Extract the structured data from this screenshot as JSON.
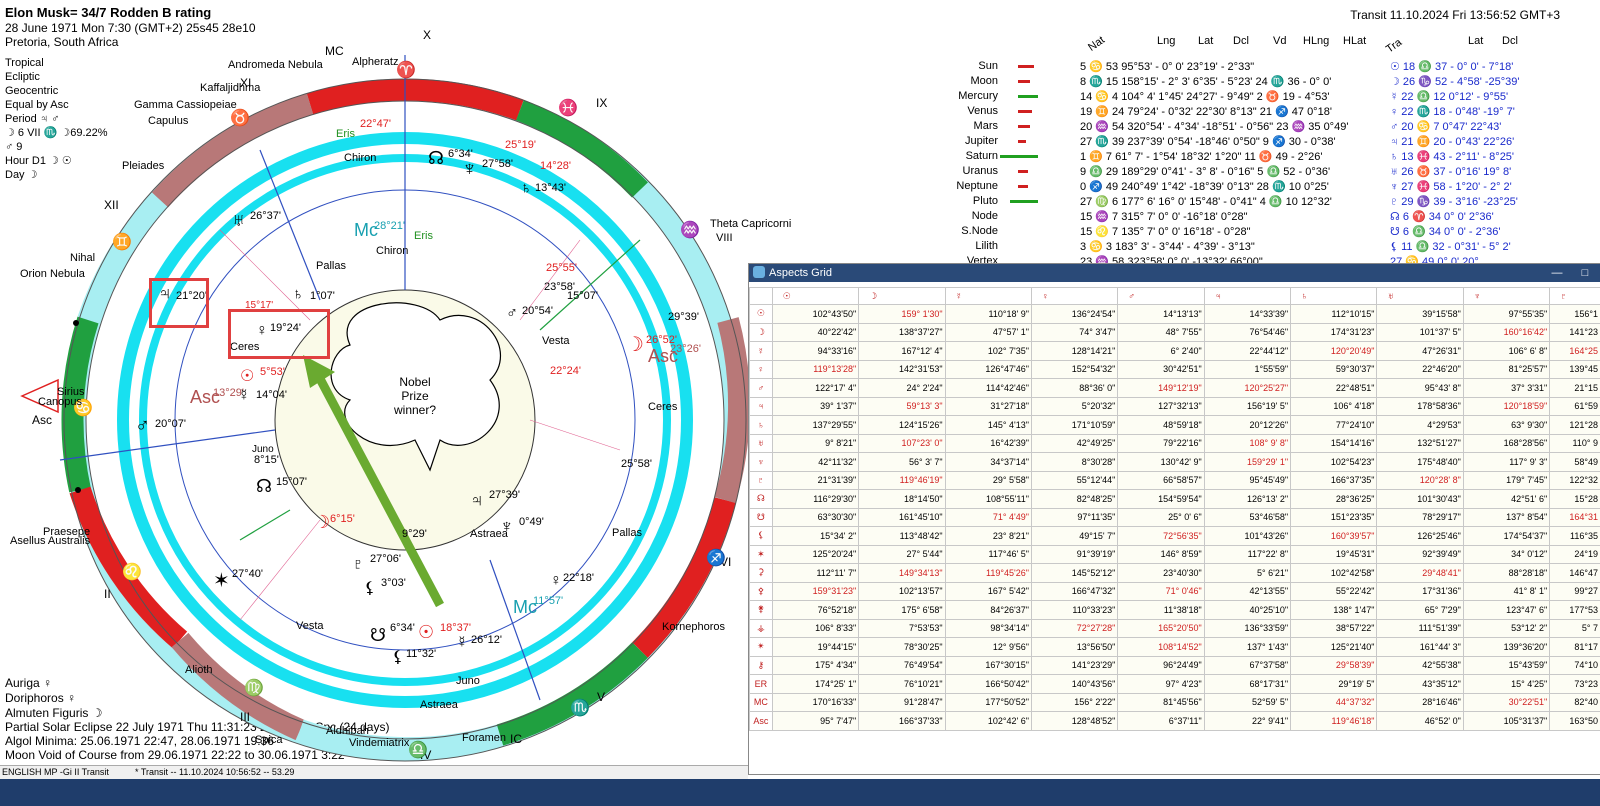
{
  "header": {
    "title": "Elon Musk= 34/7 Rodden B rating",
    "date_line": "28 June 1971  Mon   7:30 (GMT+2) 25s45  28e10",
    "place": "Pretoria, South Africa",
    "transit": "Transit 11.10.2024  Fri 13:56:52 GMT+3"
  },
  "settings": {
    "lines": [
      "Tropical",
      "Ecliptic",
      "Geocentric",
      "Equal by Asc",
      "Period ♃ ♂",
      "☽ 6 VII ♏ ☽69.22%",
      "♂ 9",
      "Hour D1 ☽ ☉",
      "Day ☽"
    ]
  },
  "bottom_info": {
    "lines": [
      "Auriga ♀",
      "Doriphoros ♀",
      "Almuten Figuris ☽",
      "Partial Solar Eclipse 22 July 1971 Thu 11:31:23 28°55'32\" Cnc (24 days)",
      "Algol Minima: 25.06.1971 22:47,  28.06.1971 19:36",
      "Moon Void of Course from 29.06.1971 22:22 to 30.06.1971  3:22"
    ]
  },
  "status": {
    "left": "ENGLISH MP -Gi II Transit",
    "tab": "* Transit -- 11.10.2024 10:56:52 -- 53.29"
  },
  "planet_table": {
    "col_nat": "Nat",
    "col_lng": "Lng",
    "col_lat": "Lat",
    "col_dcl": "Dcl",
    "col_vd": "Vd",
    "col_hlng": "HLng",
    "col_hlat": "HLat",
    "col_tra": "Tra",
    "col_tlat": "Lat",
    "col_tdcl": "Dcl",
    "rows": [
      {
        "name": "Sun",
        "val": "5 ♋ 53   95°53'  - 0° 0'   23°19'  - 2°33\"",
        "tv": "☉  18 ♎ 37  - 0° 0'   - 7°18'",
        "bar": "#d02020"
      },
      {
        "name": "Moon",
        "val": "8 ♏ 15   158°15'  - 2° 3'    6°35'  - 5°23'  24 ♏ 36  - 0° 0'",
        "tv": "☽  26 ♑ 52  - 4°58'  -25°39'",
        "bar": "#d02020"
      },
      {
        "name": "Mercury",
        "val": "14 ♋ 4   104° 4'    1°45'   24°27'  - 9°49\"   2 ♉ 19  - 4°53'",
        "tv": "☿  22 ♎ 12    0°12'   - 9°55'",
        "bar": "#20a020"
      },
      {
        "name": "Venus",
        "val": "19 ♊ 24   79°24'  - 0°32'   22°30'   8°13\"  21 ♐ 47    0°18'",
        "tv": "♀  22 ♏ 18  - 0°48'  -19° 7'",
        "bar": "#d02020"
      },
      {
        "name": "Mars",
        "val": "20 ♒ 54  320°54'  - 4°34'  -18°51'  - 0°56\"  23 ♒ 35    0°49'",
        "tv": "♂  20 ♋ 7    0°47'   22°43'",
        "bar": "#d02020"
      },
      {
        "name": "Jupiter",
        "val": "27 ♏ 39  237°39'    0°54'  -18°46'   0°50\"   9 ♐ 30  - 0°38'",
        "tv": "♃  21 ♊ 20  - 0°43'   22°26'",
        "bar": "#d02020"
      },
      {
        "name": "Saturn",
        "val": "1 ♊ 7    61° 7'  - 1°54'   18°32'   1°20\"  11 ♉ 49  - 2°26'",
        "tv": "♄  13 ♓ 43  - 2°11'  - 8°25'",
        "bar": "#20a020"
      },
      {
        "name": "Uranus",
        "val": "9 ♎ 29  189°29'    0°41'  - 3° 8'  - 0°16\"   5 ♎ 52  - 0°36'",
        "tv": "♅  26 ♉ 37  - 0°16'   19° 8'",
        "bar": "#d02020"
      },
      {
        "name": "Neptune",
        "val": "0 ♐ 49  240°49'    1°42'  -18°39'   0°13\"  28 ♏ 10    0°25'",
        "tv": "♆  27 ♓ 58  - 1°20'  - 2° 2'",
        "bar": "#d02020"
      },
      {
        "name": "Pluto",
        "val": "27 ♍ 6   177° 6'   16° 0'   15°48'  - 0°41\"   4 ♎ 10   12°32'",
        "tv": "♇  29 ♑ 39  - 3°16'  -23°25'",
        "bar": "#20a020"
      },
      {
        "name": "Node",
        "val": "15 ♒ 7   315° 7'    0° 0'  -16°18'   0°28\"",
        "tv": "☊   6 ♈ 34    0° 0'    2°36'",
        "bar": ""
      },
      {
        "name": "S.Node",
        "val": "15 ♌ 7   135° 7'    0° 0'   16°18'  - 0°28\"",
        "tv": "☋   6 ♎ 34    0° 0'  - 2°36'",
        "bar": ""
      },
      {
        "name": "Lilith",
        "val": "3 ♋ 3   183° 3'  - 3°44'  - 4°39'  - 3°13\"",
        "tv": "⚸  11 ♎ 32  - 0°31'  - 5° 2'",
        "bar": ""
      },
      {
        "name": "Vertex",
        "val": "23 ♒ 58  323°58'    0° 0'  -13°32'  66°00\"",
        "tv": "   27 ♋ 49    0° 0'   20°...",
        "bar": ""
      }
    ]
  },
  "chart": {
    "signs": {
      "aries": "♈",
      "taurus": "♉",
      "gemini": "♊",
      "cancer": "♋",
      "leo": "♌",
      "virgo": "♍",
      "libra": "♎",
      "scorpio": "♏",
      "sagittarius": "♐",
      "capricorn": "♑",
      "aquarius": "♒",
      "pisces": "♓"
    },
    "houses": {
      "x": "X",
      "xi": "XI",
      "xii": "XII",
      "ix": "IX",
      "viii": "VIII",
      "vi": "VI",
      "v": "V",
      "iv": "IV",
      "iii": "III",
      "ii": "II",
      "i": "I",
      "mc": "MC",
      "ic": "IC"
    },
    "stars": {
      "andromeda": "Andromeda Nebula",
      "alpheratz": "Alpheratz",
      "kaffaljidhma": "Kaffaljidhma",
      "gamma": "Gamma Cassiopeiae",
      "capulus": "Capulus",
      "pleiades": "Pleiades",
      "nihal": "Nihal",
      "orion": "Orion Nebula",
      "sirius": "Sirius",
      "canopus": "Canopus",
      "asc": "Asc",
      "praesepe": "Praesepe",
      "asellus": "Asellus Australis",
      "alioth": "Alioth",
      "aldhibah": "Aldhibah",
      "spica": "Spica",
      "vindemiatrix": "Vindemiatrix",
      "foramen": "Foramen",
      "kornephoros": "Kornephoros",
      "theta": "Theta Capricorni"
    },
    "labels": {
      "ceres_top": "Ceres",
      "ceres_mid": "Ceres",
      "eris_top": "Eris",
      "eris_mid": "Eris",
      "chiron_top": "Chiron",
      "chiron_mid": "Chiron",
      "pallas_top": "Pallas",
      "pallas_mid": "Pallas",
      "juno_mid": "Juno",
      "juno_bot": "Juno",
      "vesta_mid": "Vesta",
      "vesta_bot": "Vesta",
      "astraea_mid": "Astraea",
      "astraea_bot": "Astraea",
      "mc_val": "28°21'",
      "mc_t_val": "11°57'",
      "asc_val": "13°29'",
      "asc_t_val": "23°26'",
      "j_nat": "21°20'",
      "v_nat": "19°24'",
      "sun_nat": "5°53'",
      "merc_nat": "14°04'",
      "mars_nat": "20°07'",
      "moon_nat": "8°15'",
      "node_nat": "15°07'",
      "sat_nat": "1°07'",
      "ura_nat": "26°37'",
      "nep_nat": "0°49'",
      "jup2": "27°39'",
      "plu_nat": "27°06'",
      "lil_nat": "3°03'",
      "v2": "15°17'",
      "m2": "5°53'",
      "t_uranus": "22°47'",
      "t_neptune": "27°58'",
      "t_nep_red": "25°19'",
      "t_pluto": "14°28'",
      "t_sat": "13°43'",
      "t_node": "6°34'",
      "t_moon": "26°52'",
      "t_mars": "20°54'",
      "t_mars2": "15°07'",
      "t_chiron": "23°58'",
      "t_chi2": "25°55'",
      "t_ceres": "Ceres",
      "t_pallas": "Pallas",
      "t_plu": "29°39'",
      "t_lil": "22°18'",
      "t_sun": "18°37'",
      "t_mer": "26°12'",
      "t_nod": "6°34'",
      "t_lil2": "11°32'",
      "t_ast": "8°15'",
      "t_mer2": "9°29'",
      "t_ven": "22°24'",
      "t_moon2": "6°15'",
      "t_merc": "27°40'",
      "deg1": "25°58'"
    },
    "cloud": "Nobel Prize winner?"
  },
  "aspects": {
    "title": "Aspects Grid",
    "cols": [
      "☉",
      "☽",
      "☿",
      "♀",
      "♂",
      "♃",
      "♄",
      "♅",
      "♆",
      "♇"
    ],
    "rows": [
      {
        "l": "☉",
        "c": [
          "102°43'50\"",
          "159° 1'30\"",
          "110°18' 9\"",
          "136°24'54\"",
          "14°13'13\"",
          "14°33'39\"",
          "112°10'15\"",
          "39°15'58\"",
          "97°55'35\"",
          "156°1"
        ]
      },
      {
        "l": "☽",
        "c": [
          "40°22'42\"",
          "138°37'27\"",
          "47°57' 1\"",
          "74° 3'47\"",
          "48° 7'55\"",
          "76°54'46\"",
          "174°31'23\"",
          "101°37' 5\"",
          "160°16'42\"",
          "141°23"
        ]
      },
      {
        "l": "☿",
        "c": [
          "94°33'16\"",
          "167°12' 4\"",
          "102° 7'35\"",
          "128°14'21\"",
          "6° 2'40\"",
          "22°44'12\"",
          "120°20'49\"",
          "47°26'31\"",
          "106° 6' 8\"",
          "164°25"
        ]
      },
      {
        "l": "♀",
        "c": [
          "119°13'28\"",
          "142°31'53\"",
          "126°47'46\"",
          "152°54'32\"",
          "30°42'51\"",
          "1°55'59\"",
          "59°30'37\"",
          "22°46'20\"",
          "81°25'57\"",
          "139°45"
        ]
      },
      {
        "l": "♂",
        "c": [
          "122°17' 4\"",
          "24° 2'24\"",
          "114°42'46\"",
          "88°36' 0\"",
          "149°12'19\"",
          "120°25'27\"",
          "22°48'51\"",
          "95°43' 8\"",
          "37° 3'31\"",
          "21°15"
        ]
      },
      {
        "l": "♃",
        "c": [
          "39° 1'37\"",
          "59°13' 3\"",
          "31°27'18\"",
          "5°20'32\"",
          "127°32'13\"",
          "156°19' 5\"",
          "106° 4'18\"",
          "178°58'36\"",
          "120°18'59\"",
          "61°59"
        ]
      },
      {
        "l": "♄",
        "c": [
          "137°29'55\"",
          "124°15'26\"",
          "145° 4'13\"",
          "171°10'59\"",
          "48°59'18\"",
          "20°12'26\"",
          "77°24'10\"",
          "4°29'53\"",
          "63° 9'30\"",
          "121°28"
        ]
      },
      {
        "l": "♅",
        "c": [
          "9° 8'21\"",
          "107°23' 0\"",
          "16°42'39\"",
          "42°49'25\"",
          "79°22'16\"",
          "108° 9' 8\"",
          "154°14'16\"",
          "132°51'27\"",
          "168°28'56\"",
          "110° 9"
        ]
      },
      {
        "l": "♆",
        "c": [
          "42°11'32\"",
          "56° 3' 7\"",
          "34°37'14\"",
          "8°30'28\"",
          "130°42' 9\"",
          "159°29' 1\"",
          "102°54'23\"",
          "175°48'40\"",
          "117° 9' 3\"",
          "58°49"
        ]
      },
      {
        "l": "♇",
        "c": [
          "21°31'39\"",
          "119°46'19\"",
          "29° 5'58\"",
          "55°12'44\"",
          "66°58'57\"",
          "95°45'49\"",
          "166°37'35\"",
          "120°28' 8\"",
          "179° 7'45\"",
          "122°32"
        ]
      },
      {
        "l": "☊",
        "c": [
          "116°29'30\"",
          "18°14'50\"",
          "108°55'11\"",
          "82°48'25\"",
          "154°59'54\"",
          "126°13' 2\"",
          "28°36'25\"",
          "101°30'43\"",
          "42°51' 6\"",
          "15°28"
        ]
      },
      {
        "l": "☋",
        "c": [
          "63°30'30\"",
          "161°45'10\"",
          "71° 4'49\"",
          "97°11'35\"",
          "25° 0' 6\"",
          "53°46'58\"",
          "151°23'35\"",
          "78°29'17\"",
          "137° 8'54\"",
          "164°31"
        ]
      },
      {
        "l": "⚸",
        "c": [
          "15°34' 2\"",
          "113°48'42\"",
          "23° 8'21\"",
          "49°15' 7\"",
          "72°56'35\"",
          "101°43'26\"",
          "160°39'57\"",
          "126°25'46\"",
          "174°54'37\"",
          "116°35"
        ]
      },
      {
        "l": "✶",
        "c": [
          "125°20'24\"",
          "27° 5'44\"",
          "117°46' 5\"",
          "91°39'19\"",
          "146° 8'59\"",
          "117°22' 8\"",
          "19°45'31\"",
          "92°39'49\"",
          "34° 0'12\"",
          "24°19"
        ]
      },
      {
        "l": "⚳",
        "c": [
          "112°11' 7\"",
          "149°34'13\"",
          "119°45'26\"",
          "145°52'12\"",
          "23°40'30\"",
          "5° 6'21\"",
          "102°42'58\"",
          "29°48'41\"",
          "88°28'18\"",
          "146°47"
        ]
      },
      {
        "l": "⚴",
        "c": [
          "159°31'23\"",
          "102°13'57\"",
          "167° 5'42\"",
          "166°47'32\"",
          "71° 0'46\"",
          "42°13'55\"",
          "55°22'42\"",
          "17°31'36\"",
          "41° 8' 1\"",
          "99°27"
        ]
      },
      {
        "l": "⚵",
        "c": [
          "76°52'18\"",
          "175° 6'58\"",
          "84°26'37\"",
          "110°33'23\"",
          "11°38'18\"",
          "40°25'10\"",
          "138° 1'47\"",
          "65° 7'29\"",
          "123°47' 6\"",
          "177°53"
        ]
      },
      {
        "l": "⚶",
        "c": [
          "106° 8'33\"",
          "7°53'53\"",
          "98°34'14\"",
          "72°27'28\"",
          "165°20'50\"",
          "136°33'59\"",
          "38°57'22\"",
          "111°51'39\"",
          "53°12' 2\"",
          "5° 7"
        ]
      },
      {
        "l": "✴",
        "c": [
          "19°44'15\"",
          "78°30'25\"",
          "12° 9'56\"",
          "13°56'50\"",
          "108°14'52\"",
          "137° 1'43\"",
          "125°21'40\"",
          "161°44' 3\"",
          "139°36'20\"",
          "81°17"
        ]
      },
      {
        "l": "⚷",
        "c": [
          "175° 4'34\"",
          "76°49'54\"",
          "167°30'15\"",
          "141°23'29\"",
          "96°24'49\"",
          "67°37'58\"",
          "29°58'39\"",
          "42°55'38\"",
          "15°43'59\"",
          "74°10"
        ]
      },
      {
        "l": "ER",
        "c": [
          "174°25' 1\"",
          "76°10'21\"",
          "166°50'42\"",
          "140°43'56\"",
          "97° 4'23\"",
          "68°17'31\"",
          "29°19' 5\"",
          "43°35'12\"",
          "15° 4'25\"",
          "73°23"
        ]
      },
      {
        "l": "MC",
        "c": [
          "170°16'33\"",
          "91°28'47\"",
          "177°50'52\"",
          "156° 2'22\"",
          "81°45'56\"",
          "52°59' 5\"",
          "44°37'32\"",
          "28°16'46\"",
          "30°22'51\"",
          "82°40"
        ]
      },
      {
        "l": "Asc",
        "c": [
          "95° 7'47\"",
          "166°37'33\"",
          "102°42' 6\"",
          "128°48'52\"",
          "6°37'11\"",
          "22° 9'41\"",
          "119°46'18\"",
          "46°52' 0\"",
          "105°31'37\"",
          "163°50"
        ]
      }
    ]
  }
}
